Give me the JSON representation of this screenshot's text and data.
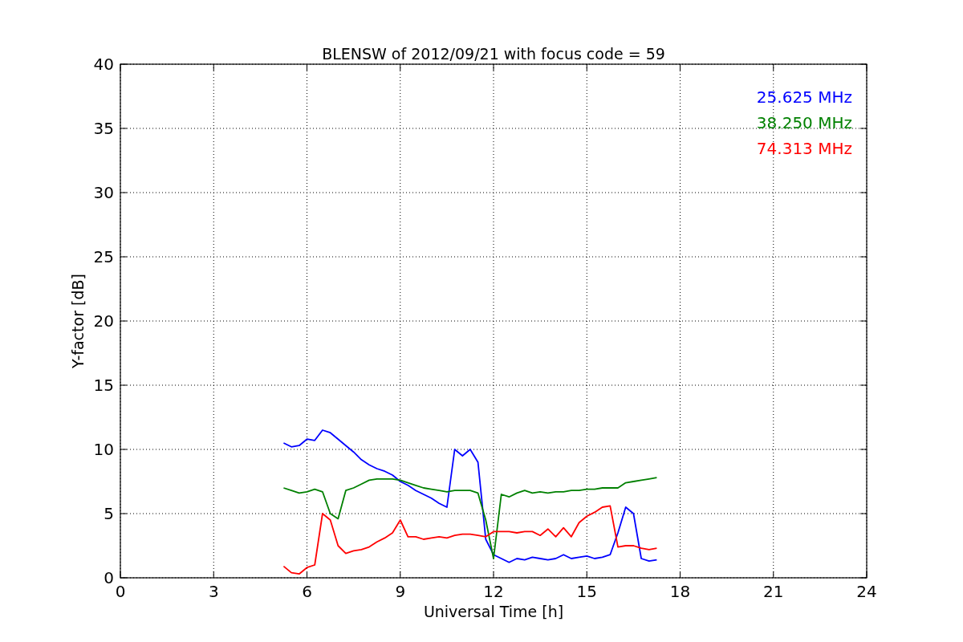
{
  "figure": {
    "chart_data": {
      "type": "line",
      "title": "BLENSW of 2012/09/21 with focus code = 59",
      "xlabel": "Universal Time [h]",
      "ylabel": "Y-factor [dB]",
      "x": [
        5.25,
        5.5,
        5.75,
        6,
        6.25,
        6.5,
        6.75,
        7,
        7.25,
        7.5,
        7.75,
        8,
        8.25,
        8.5,
        8.75,
        9,
        9.25,
        9.5,
        9.75,
        10,
        10.25,
        10.5,
        10.75,
        11,
        11.25,
        11.5,
        11.75,
        12,
        12.25,
        12.5,
        12.75,
        13,
        13.25,
        13.5,
        13.75,
        14,
        14.25,
        14.5,
        14.75,
        15,
        15.25,
        15.5,
        15.75,
        16,
        16.25,
        16.5,
        16.75,
        17,
        17.25
      ],
      "series": [
        {
          "name": "25.625 MHz",
          "color": "#0000ff",
          "values": [
            10.5,
            10.2,
            10.3,
            10.8,
            10.7,
            11.5,
            11.3,
            10.8,
            10.3,
            9.8,
            9.2,
            8.8,
            8.5,
            8.3,
            8.0,
            7.5,
            7.2,
            6.8,
            6.5,
            6.2,
            5.8,
            5.5,
            10,
            9.5,
            10,
            9,
            3,
            1.8,
            1.5,
            1.2,
            1.5,
            1.4,
            1.6,
            1.5,
            1.4,
            1.5,
            1.8,
            1.5,
            1.6,
            1.7,
            1.5,
            1.6,
            1.8,
            3.5,
            5.5,
            5.0,
            1.5,
            1.3,
            1.4
          ]
        },
        {
          "name": "38.250 MHz",
          "color": "#008000",
          "values": [
            7.0,
            6.8,
            6.6,
            6.7,
            6.9,
            6.7,
            5.0,
            4.6,
            6.8,
            7.0,
            7.3,
            7.6,
            7.7,
            7.7,
            7.7,
            7.6,
            7.4,
            7.2,
            7.0,
            6.9,
            6.8,
            6.7,
            6.8,
            6.8,
            6.8,
            6.6,
            4.5,
            1.5,
            6.5,
            6.3,
            6.6,
            6.8,
            6.6,
            6.7,
            6.6,
            6.7,
            6.7,
            6.8,
            6.8,
            6.9,
            6.9,
            7.0,
            7.0,
            7.0,
            7.4,
            7.5,
            7.6,
            7.7,
            7.8
          ]
        },
        {
          "name": "74.313 MHz",
          "color": "#ff0000",
          "values": [
            0.9,
            0.4,
            0.3,
            0.8,
            1.0,
            5.0,
            4.5,
            2.5,
            1.9,
            2.1,
            2.2,
            2.4,
            2.8,
            3.1,
            3.5,
            4.5,
            3.2,
            3.2,
            3.0,
            3.1,
            3.2,
            3.1,
            3.3,
            3.4,
            3.4,
            3.3,
            3.2,
            3.6,
            3.6,
            3.6,
            3.5,
            3.6,
            3.6,
            3.3,
            3.8,
            3.2,
            3.9,
            3.2,
            4.3,
            4.8,
            5.1,
            5.5,
            5.6,
            2.4,
            2.5,
            2.5,
            2.3,
            2.2,
            2.3
          ]
        }
      ],
      "grid": true,
      "xlim": [
        0,
        24
      ],
      "ylim": [
        0,
        40
      ],
      "xticks": [
        0,
        3,
        6,
        9,
        12,
        15,
        18,
        21,
        24
      ],
      "yticks": [
        0,
        5,
        10,
        15,
        20,
        25,
        30,
        35,
        40
      ]
    }
  }
}
